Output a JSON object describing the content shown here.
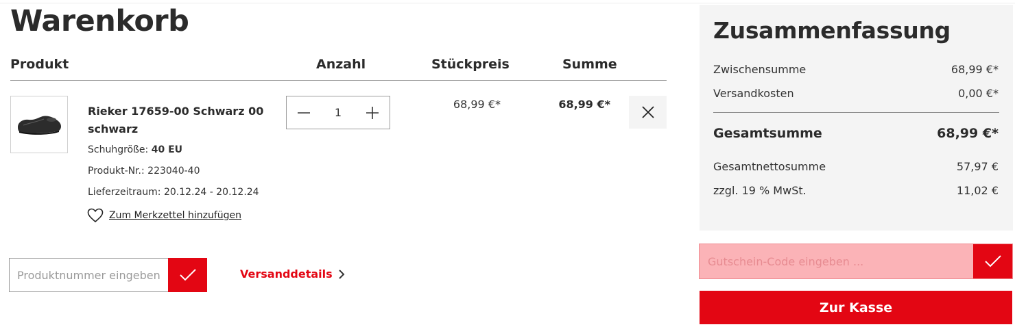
{
  "cart": {
    "title": "Warenkorb",
    "columns": {
      "product": "Produkt",
      "quantity": "Anzahl",
      "unit_price": "Stückpreis",
      "total": "Summe"
    },
    "items": [
      {
        "name": "Rieker 17659-00 Schwarz 00 schwarz",
        "size_label": "Schuhgröße:",
        "size_value": "40 EU",
        "article_number": "Produkt-Nr.: 223040-40",
        "delivery": "Lieferzeitraum: 20.12.24 - 20.12.24",
        "wishlist_label": "Zum Merkzettel hinzufügen",
        "quantity": "1",
        "unit_price": "68,99 €*",
        "total": "68,99 €*",
        "image_icon": "black-shoe-image"
      }
    ],
    "product_number_input": {
      "placeholder": "Produktnummer eingeben",
      "value": ""
    },
    "shipping_details_label": "Versanddetails"
  },
  "summary": {
    "title": "Zusammenfassung",
    "subtotal_label": "Zwischensumme",
    "subtotal_value": "68,99 €*",
    "shipping_label": "Versandkosten",
    "shipping_value": "0,00 €*",
    "grand_total_label": "Gesamtsumme",
    "grand_total_value": "68,99 €*",
    "net_total_label": "Gesamtnettosumme",
    "net_total_value": "57,97 €",
    "vat_label": "zzgl. 19 % MwSt.",
    "vat_value": "11,02 €"
  },
  "voucher": {
    "placeholder": "Gutschein-Code eingeben ...",
    "value": ""
  },
  "checkout_label": "Zur Kasse",
  "colors": {
    "accent": "#e30613",
    "summary_bg": "#f4f4f4",
    "voucher_bg": "#fbb3b7"
  }
}
